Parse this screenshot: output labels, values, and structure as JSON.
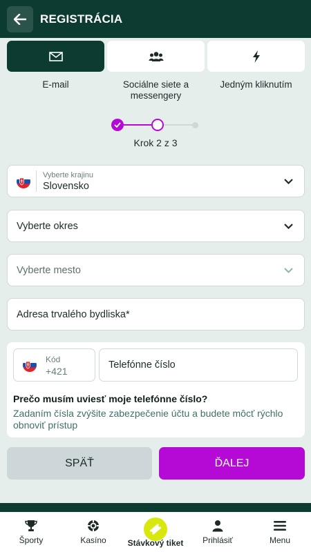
{
  "header": {
    "title": "REGISTRÁCIA",
    "back_icon": "arrow-left-icon"
  },
  "methods": [
    {
      "label": "E-mail",
      "icon": "envelope-icon",
      "active": true
    },
    {
      "label": "Sociálne siete a messengery",
      "icon": "users-icon",
      "active": false
    },
    {
      "label": "Jedným kliknutím",
      "icon": "lightning-icon",
      "active": false
    }
  ],
  "stepper": {
    "label": "Krok 2 z 3",
    "current": 2,
    "total": 3
  },
  "fields": {
    "country": {
      "sublabel": "Vyberte krajinu",
      "value": "Slovensko"
    },
    "district": {
      "placeholder": "Vyberte okres"
    },
    "city": {
      "placeholder": "Vyberte mesto"
    },
    "address": {
      "placeholder": "Adresa trvalého bydliska*"
    }
  },
  "phone": {
    "code_label": "Kód",
    "code_value": "+421",
    "number_placeholder": "Telefónne číslo",
    "why_title": "Prečo musím uviesť moje telefónne číslo?",
    "why_text": "Zadaním čísla zvýšite zabezpečenie účtu a budete môcť rýchlo obnoviť prístup"
  },
  "buttons": {
    "back": "SPÄŤ",
    "next": "ĎALEJ"
  },
  "nav": [
    {
      "label": "Športy",
      "icon": "trophy-icon"
    },
    {
      "label": "Kasíno",
      "icon": "casino-chip-icon"
    },
    {
      "label": "Stávkový tiket",
      "icon": "ticket-icon"
    },
    {
      "label": "Prihlásiť",
      "icon": "user-icon"
    },
    {
      "label": "Menu",
      "icon": "hamburger-menu-icon"
    }
  ],
  "colors": {
    "primary_dark": "#0c3b31",
    "accent_purple": "#b50ad6",
    "ticket_yellow": "#d8e80f"
  }
}
